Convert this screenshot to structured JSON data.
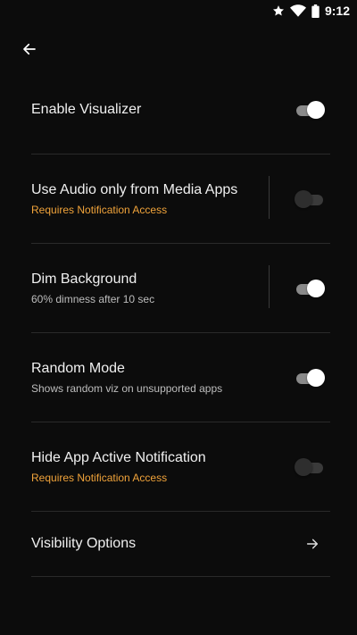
{
  "status": {
    "time": "9:12",
    "icons": [
      "star-icon",
      "wifi-icon",
      "battery-icon"
    ]
  },
  "nav": {
    "back_icon": "arrow-left-icon"
  },
  "settings": [
    {
      "title": "Enable Visualizer",
      "subtitle": "",
      "control": "toggle",
      "on": true,
      "divider": false
    },
    {
      "title": "Use Audio only from Media Apps",
      "subtitle": "Requires Notification Access",
      "subtitle_style": "warn",
      "control": "toggle",
      "on": false,
      "divider": true
    },
    {
      "title": "Dim Background",
      "subtitle": "60% dimness after 10 sec",
      "control": "toggle",
      "on": true,
      "divider": true
    },
    {
      "title": "Random Mode",
      "subtitle": "Shows random viz on unsupported apps",
      "control": "toggle",
      "on": true,
      "divider": false
    },
    {
      "title": "Hide App Active Notification",
      "subtitle": "Requires Notification Access",
      "subtitle_style": "warn",
      "control": "toggle",
      "on": false,
      "divider": false
    },
    {
      "title": "Visibility Options",
      "subtitle": "",
      "control": "chevron",
      "icon": "arrow-right-icon"
    }
  ],
  "colors": {
    "background": "#0c0c0c",
    "accent_warn": "#f0a33a",
    "text": "#f0f0f0"
  }
}
